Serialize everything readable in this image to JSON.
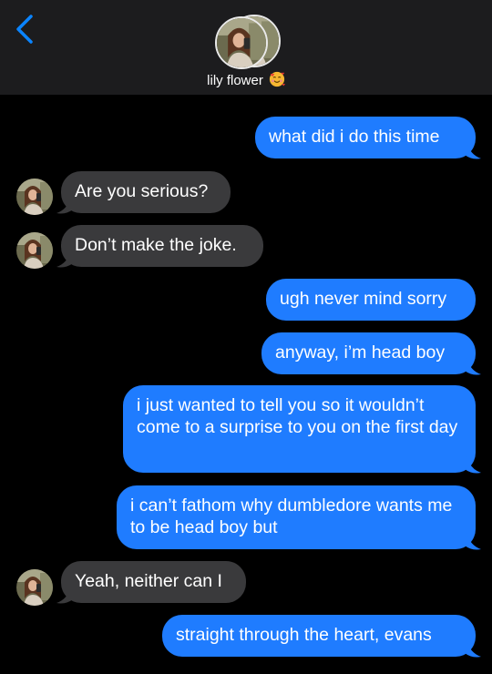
{
  "contact": {
    "name": "lily flower",
    "emoji": "smiling-face-with-hearts-icon"
  },
  "colors": {
    "sent_bubble": "#1f7cff",
    "received_bubble": "#3a3a3c",
    "header_bg": "#1c1c1e",
    "back_chevron": "#0a84ff"
  },
  "messages": [
    {
      "from": "me",
      "text": "what did i do this time"
    },
    {
      "from": "them",
      "text": "Are you serious?"
    },
    {
      "from": "them",
      "text": "Don’t make the joke."
    },
    {
      "from": "me",
      "text": "ugh never mind sorry"
    },
    {
      "from": "me",
      "text": "anyway, i’m head boy"
    },
    {
      "from": "me",
      "text": "i just wanted to tell you so it wouldn’t come to a surprise to you on the first day"
    },
    {
      "from": "me",
      "text": "i can’t fathom why dumbledore wants me to be head boy but"
    },
    {
      "from": "them",
      "text": "Yeah, neither can I"
    },
    {
      "from": "me",
      "text": "straight through the heart, evans"
    }
  ]
}
